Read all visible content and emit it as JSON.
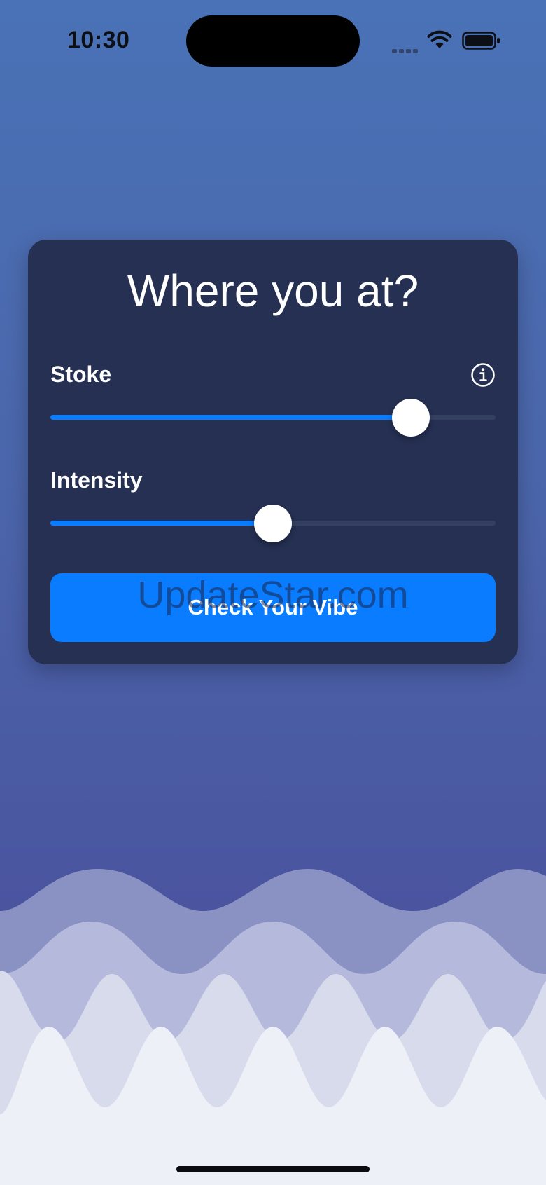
{
  "status_bar": {
    "time": "10:30",
    "icons": [
      "signal-icon",
      "wifi-icon",
      "battery-icon"
    ]
  },
  "card": {
    "title": "Where you at?",
    "sliders": [
      {
        "label": "Stoke",
        "value_fraction": 0.81,
        "has_info": true
      },
      {
        "label": "Intensity",
        "value_fraction": 0.5,
        "has_info": false
      }
    ],
    "button_label": "Check Your Vibe"
  },
  "watermark": "UpdateStar.com",
  "colors": {
    "accent": "#0a7cff",
    "card_bg": "#253052",
    "track": "#34405f",
    "background_top": "#4a72b6",
    "background_bottom": "#4a4f9a"
  }
}
